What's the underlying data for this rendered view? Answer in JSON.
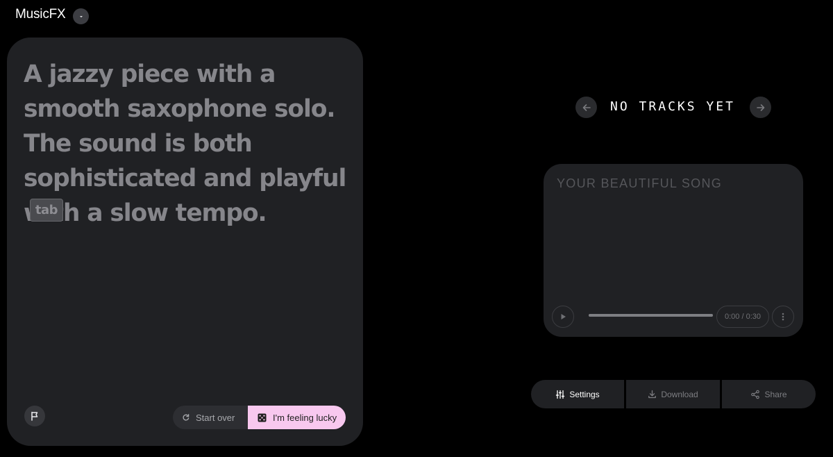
{
  "header": {
    "app_name": "MusicFX",
    "menu_icon": "chevron-down-icon"
  },
  "prompt": {
    "text": "A jazzy piece with a smooth saxophone solo. The sound is both sophisticated and playful with a slow tempo.",
    "tab_hint": "tab",
    "flag_icon": "flag-icon",
    "start_over_label": "Start over",
    "start_over_icon": "refresh-icon",
    "lucky_label": "I'm feeling lucky",
    "lucky_icon": "dice-icon"
  },
  "tracks": {
    "status_label": "NO TRACKS YET",
    "prev_icon": "arrow-left-icon",
    "next_icon": "arrow-right-icon"
  },
  "song": {
    "title": "YOUR BEAUTIFUL SONG",
    "time": "0:00 / 0:30",
    "progress_fraction": 1.0,
    "play_icon": "play-icon",
    "more_icon": "more-vertical-icon"
  },
  "actions": {
    "settings_label": "Settings",
    "download_label": "Download",
    "share_label": "Share",
    "settings_icon": "sliders-icon",
    "download_icon": "download-icon",
    "share_icon": "share-icon"
  },
  "colors": {
    "background": "#000000",
    "card": "#202124",
    "accent_lucky": "#f8c8ef",
    "prompt_text": "#86868b"
  }
}
